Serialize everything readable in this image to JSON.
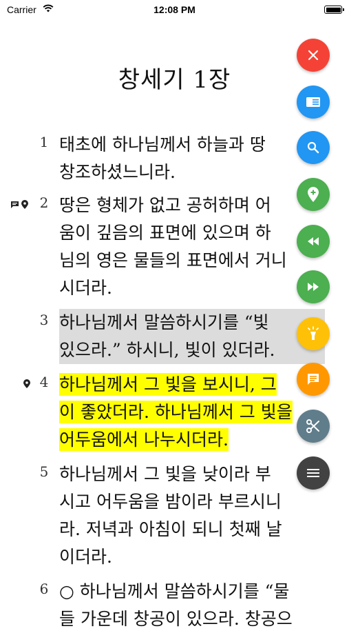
{
  "status_bar": {
    "carrier": "Carrier",
    "time": "12:08 PM"
  },
  "chapter_title": "창세기 1장",
  "verses": [
    {
      "number": "1",
      "lines": [
        "태초에 하나님께서 하늘과 땅",
        "창조하셨느니라."
      ]
    },
    {
      "number": "2",
      "lines": [
        "땅은 형체가 없고 공허하며 어",
        "움이 깊음의 표면에 있으며 하",
        "님의 영은 물들의 표면에서 거니",
        "시더라."
      ],
      "markers": [
        "note-icon",
        "pin-icon"
      ]
    },
    {
      "number": "3",
      "lines": [
        "하나님께서 말씀하시기를 “빛",
        "있으라.” 하시니, 빛이 있더라."
      ],
      "highlight": "#dcdcdc"
    },
    {
      "number": "4",
      "lines": [
        "하나님께서 그 빛을 보시니, 그",
        "이 좋았더라. 하나님께서 그 빛을",
        "어두움에서 나누시더라."
      ],
      "highlight": "#ffff00",
      "markers": [
        "pin-icon"
      ]
    },
    {
      "number": "5",
      "lines": [
        "하나님께서 그 빛을 낮이라 부",
        "시고 어두움을 밤이라 부르시니",
        "라. 저녁과 아침이 되니 첫째 날",
        "이더라."
      ]
    },
    {
      "number": "6",
      "lines": [
        "○ 하나님께서 말씀하시기를 “물",
        "들 가운데 창공이 있으라. 창공으"
      ]
    }
  ],
  "fabs": [
    {
      "name": "close-button",
      "icon": "close-icon",
      "color": "#f44336"
    },
    {
      "name": "reader-button",
      "icon": "reader-icon",
      "color": "#2196f3"
    },
    {
      "name": "search-button",
      "icon": "search-icon",
      "color": "#2196f3"
    },
    {
      "name": "add-location-button",
      "icon": "add-location-icon",
      "color": "#4caf50"
    },
    {
      "name": "rewind-button",
      "icon": "rewind-icon",
      "color": "#4caf50"
    },
    {
      "name": "fast-forward-button",
      "icon": "fast-forward-icon",
      "color": "#4caf50"
    },
    {
      "name": "highlight-button",
      "icon": "highlighter-icon",
      "color": "#ffc107"
    },
    {
      "name": "comment-button",
      "icon": "comment-icon",
      "color": "#ff9800"
    },
    {
      "name": "cut-button",
      "icon": "scissors-icon",
      "color": "#607d8b"
    },
    {
      "name": "menu-button",
      "icon": "menu-icon",
      "color": "#424242"
    }
  ]
}
